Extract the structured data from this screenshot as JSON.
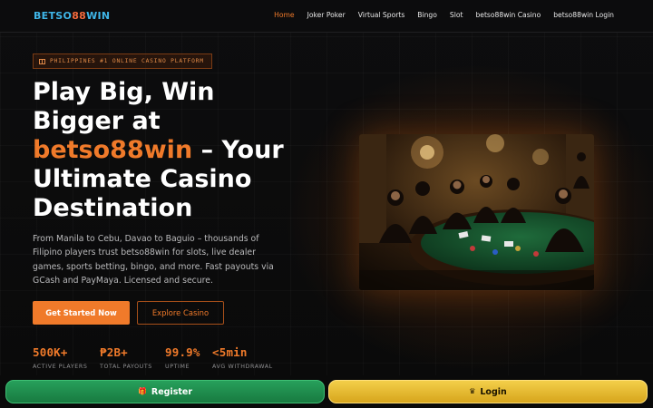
{
  "brand": {
    "part1": "BETSO",
    "part2": "88",
    "part3": "WIN"
  },
  "nav": {
    "items": [
      {
        "label": "Home",
        "active": true
      },
      {
        "label": "Joker Poker"
      },
      {
        "label": "Virtual Sports"
      },
      {
        "label": "Bingo"
      },
      {
        "label": "Slot"
      },
      {
        "label": "betso88win Casino"
      },
      {
        "label": "betso88win Login"
      }
    ]
  },
  "hero": {
    "badge": "PHILIPPINES #1 ONLINE CASINO PLATFORM",
    "title_line1": "Play Big, Win",
    "title_line2": "Bigger at",
    "title_accent": "betso88win",
    "title_rest": " – Your Ultimate Casino Destination",
    "description": "From Manila to Cebu, Davao to Baguio – thousands of Filipino players trust betso88win for slots, live dealer games, sports betting, bingo, and more. Fast payouts via GCash and PayMaya. Licensed and secure.",
    "cta_primary": "Get Started Now",
    "cta_secondary": "Explore Casino"
  },
  "stats": [
    {
      "value": "500K+",
      "label": "ACTIVE PLAYERS"
    },
    {
      "value": "₱2B+",
      "label": "TOTAL PAYOUTS"
    },
    {
      "value": "99.9%",
      "label": "UPTIME"
    },
    {
      "value": "<5min",
      "label": "AVG WITHDRAWAL"
    }
  ],
  "footer": {
    "register_label": "Register",
    "login_label": "Login"
  },
  "colors": {
    "accent": "#f07a2a",
    "register": "#27a05b",
    "login": "#f3cf4a",
    "logo_blue": "#3fb6e8"
  }
}
